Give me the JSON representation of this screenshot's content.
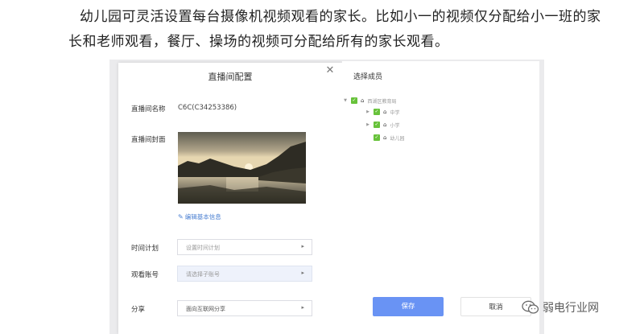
{
  "caption": {
    "line1": "幼儿园可灵活设置每台摄像机视频观看的家长。比如小一的视频仅分配给小一班的家",
    "line2": "长和老师观看，餐厅、操场的视频可分配给所有的家长观看。"
  },
  "modal": {
    "title": "直播间配置",
    "close_symbol": "✕",
    "name_label": "直播间名称",
    "name_value": "C6C(C34253386)",
    "cover_label": "直播间封面",
    "edit_link": "编辑基本信息",
    "schedule_label": "时间计划",
    "schedule_placeholder": "设置时间计划",
    "account_label": "观看账号",
    "account_placeholder": "请选择子账号",
    "share_label": "分享",
    "share_value": "面向互联网分享",
    "caret": "▸"
  },
  "members": {
    "title": "选择成员",
    "tree": [
      {
        "label": "西湖区教育局",
        "level": 0
      },
      {
        "label": "中学",
        "level": 1
      },
      {
        "label": "小学",
        "level": 1
      },
      {
        "label": "幼儿园",
        "level": 1
      }
    ]
  },
  "buttons": {
    "save": "保存",
    "cancel": "取消"
  },
  "watermark": {
    "text": "弱电行业网"
  },
  "icons": {
    "close": "close-icon",
    "edit": "pencil-icon",
    "caret": "chevron-right-icon",
    "tree_arrow": "tree-expand-arrow-icon",
    "checkbox": "checkbox-checked-icon",
    "org": "org-building-icon",
    "watermark": "wechat-logo-icon"
  },
  "colors": {
    "accent": "#6993f4",
    "checkbox": "#67c23a",
    "link": "#4a7fd1",
    "backdrop": "#ebebed"
  }
}
